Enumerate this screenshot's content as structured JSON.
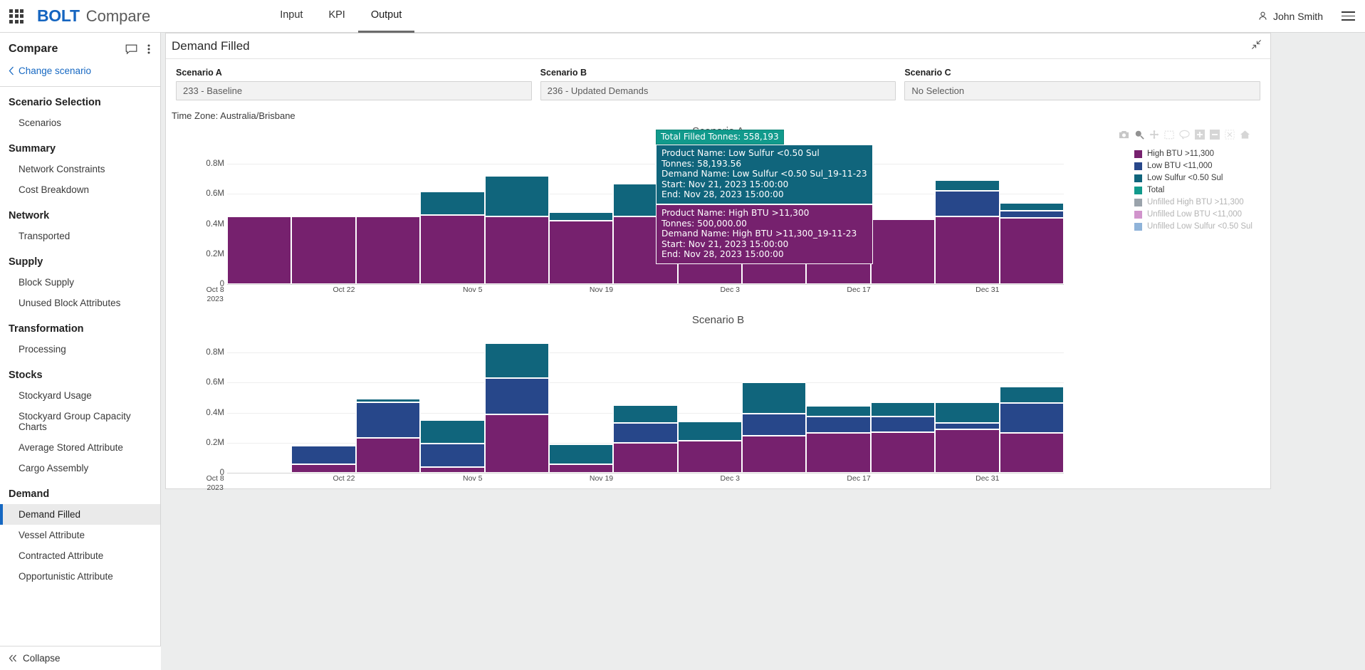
{
  "topbar": {
    "app_grid_icon": "waffle-grid-icon",
    "brand_primary": "BOLT",
    "brand_secondary": "Compare",
    "nav": [
      {
        "label": "Input",
        "active": false
      },
      {
        "label": "KPI",
        "active": false
      },
      {
        "label": "Output",
        "active": true
      }
    ],
    "user_name": "John Smith",
    "user_icon": "person-icon",
    "menu_icon": "hamburger-icon"
  },
  "sidebar": {
    "title": "Compare",
    "comment_icon": "comment-icon",
    "more_icon": "more-vertical-icon",
    "change_scenario": "Change scenario",
    "back_icon": "chevron-left-icon",
    "collapse_label": "Collapse",
    "collapse_icon": "double-chevron-left-icon",
    "groups": [
      {
        "title": "Scenario Selection",
        "items": [
          {
            "label": "Scenarios",
            "active": false
          }
        ]
      },
      {
        "title": "Summary",
        "items": [
          {
            "label": "Network Constraints",
            "active": false
          },
          {
            "label": "Cost Breakdown",
            "active": false
          }
        ]
      },
      {
        "title": "Network",
        "items": [
          {
            "label": "Transported",
            "active": false
          }
        ]
      },
      {
        "title": "Supply",
        "items": [
          {
            "label": "Block Supply",
            "active": false
          },
          {
            "label": "Unused Block Attributes",
            "active": false
          }
        ]
      },
      {
        "title": "Transformation",
        "items": [
          {
            "label": "Processing",
            "active": false
          }
        ]
      },
      {
        "title": "Stocks",
        "items": [
          {
            "label": "Stockyard Usage",
            "active": false
          },
          {
            "label": "Stockyard Group Capacity Charts",
            "active": false
          },
          {
            "label": "Average Stored Attribute",
            "active": false
          },
          {
            "label": "Cargo Assembly",
            "active": false
          }
        ]
      },
      {
        "title": "Demand",
        "items": [
          {
            "label": "Demand Filled",
            "active": true
          },
          {
            "label": "Vessel Attribute",
            "active": false
          },
          {
            "label": "Contracted Attribute",
            "active": false
          },
          {
            "label": "Opportunistic Attribute",
            "active": false
          }
        ]
      }
    ]
  },
  "panel": {
    "title": "Demand Filled",
    "collapse_icon": "collapse-diagonal-icon",
    "scenarios": [
      {
        "label": "Scenario A",
        "value": "233 - Baseline"
      },
      {
        "label": "Scenario B",
        "value": "236 - Updated Demands"
      },
      {
        "label": "Scenario C",
        "value": "No Selection"
      }
    ],
    "timezone": "Time Zone: Australia/Brisbane",
    "toolbar_icons": [
      "camera-icon",
      "zoom-icon",
      "pan-icon",
      "box-select-icon",
      "lasso-select-icon",
      "zoom-in-icon",
      "zoom-out-icon",
      "autoscale-icon",
      "reset-axes-home-icon"
    ]
  },
  "tooltip": {
    "total_label": "Total Filled Tonnes: 558,193",
    "blocks": [
      {
        "color": "#10657c",
        "lines": [
          "Product Name: Low Sulfur <0.50 Sul",
          "Tonnes: 58,193.56",
          "Demand Name: Low Sulfur <0.50 Sul_19-11-23",
          "Start: Nov 21, 2023 15:00:00",
          "End: Nov 28, 2023 15:00:00"
        ]
      },
      {
        "color": "#76216e",
        "lines": [
          "Product Name: High BTU >11,300",
          "Tonnes: 500,000.00",
          "Demand Name: High BTU >11,300_19-11-23",
          "Start: Nov 21, 2023 15:00:00",
          "End: Nov 28, 2023 15:00:00"
        ]
      }
    ]
  },
  "colors": {
    "high_btu": "#76216e",
    "low_btu": "#27478a",
    "low_sulfur": "#10657c",
    "total": "#119a8c",
    "unfilled_high_btu": "#9aa3ab",
    "unfilled_low_btu": "#d194cc",
    "unfilled_low_sulfur": "#8fb3d9",
    "accent_blue": "#1668c2"
  },
  "chart_data": [
    {
      "type": "bar",
      "title": "Scenario A",
      "barmode": "stacked",
      "xlabel": "",
      "ylabel": "",
      "ylim": [
        0,
        900000
      ],
      "yticks": [
        0,
        200000,
        400000,
        600000,
        800000
      ],
      "ytick_labels": [
        "0",
        "0.2M",
        "0.4M",
        "0.6M",
        "0.8M"
      ],
      "grid": true,
      "legend_position": "right",
      "xtick_labels": [
        "Oct 8\n2023",
        "Oct 22",
        "Nov 5",
        "Nov 19",
        "Dec 3",
        "Dec 17",
        "Dec 31"
      ],
      "categories": [
        "Oct 8",
        "Oct 15",
        "Oct 22",
        "Oct 29",
        "Nov 5",
        "Nov 12",
        "Nov 19",
        "Nov 26",
        "Dec 3",
        "Dec 10",
        "Dec 17",
        "Dec 24",
        "Dec 31"
      ],
      "series": [
        {
          "name": "High BTU >11,300",
          "color": "#76216e",
          "values": [
            450000,
            450000,
            450000,
            460000,
            450000,
            420000,
            450000,
            500000,
            500000,
            450000,
            430000,
            450000,
            440000
          ]
        },
        {
          "name": "Low BTU <11,000",
          "color": "#27478a",
          "values": [
            0,
            0,
            0,
            0,
            0,
            0,
            0,
            0,
            0,
            0,
            0,
            170000,
            50000
          ]
        },
        {
          "name": "Low Sulfur <0.50 Sul",
          "color": "#10657c",
          "values": [
            0,
            0,
            0,
            155000,
            270000,
            60000,
            220000,
            58193,
            30000,
            0,
            0,
            70000,
            50000
          ]
        },
        {
          "name": "Total",
          "color": "#119a8c",
          "values": []
        },
        {
          "name": "Unfilled High BTU >11,300",
          "color": "#9aa3ab",
          "values": []
        },
        {
          "name": "Unfilled Low BTU <11,000",
          "color": "#d194cc",
          "values": []
        },
        {
          "name": "Unfilled Low Sulfur <0.50 Sul",
          "color": "#8fb3d9",
          "values": []
        }
      ]
    },
    {
      "type": "bar",
      "title": "Scenario B",
      "barmode": "stacked",
      "xlabel": "",
      "ylabel": "",
      "ylim": [
        0,
        900000
      ],
      "yticks": [
        0,
        200000,
        400000,
        600000,
        800000
      ],
      "ytick_labels": [
        "0",
        "0.2M",
        "0.4M",
        "0.6M",
        "0.8M"
      ],
      "grid": true,
      "legend_position": "right",
      "xtick_labels": [
        "Oct 8\n2023",
        "Oct 22",
        "Nov 5",
        "Nov 19",
        "Dec 3",
        "Dec 17",
        "Dec 31"
      ],
      "categories": [
        "Oct 8",
        "Oct 15",
        "Oct 22",
        "Oct 29",
        "Nov 5",
        "Nov 12",
        "Nov 19",
        "Nov 26",
        "Dec 3",
        "Dec 10",
        "Dec 17",
        "Dec 24",
        "Dec 31"
      ],
      "series": [
        {
          "name": "High BTU >11,300",
          "color": "#76216e",
          "values": [
            8000,
            55000,
            230000,
            40000,
            390000,
            55000,
            200000,
            215000,
            245000,
            265000,
            270000,
            290000,
            265000
          ]
        },
        {
          "name": "Low BTU <11,000",
          "color": "#27478a",
          "values": [
            0,
            125000,
            240000,
            155000,
            240000,
            0,
            130000,
            0,
            150000,
            110000,
            105000,
            40000,
            200000
          ]
        },
        {
          "name": "Low Sulfur <0.50 Sul",
          "color": "#10657c",
          "values": [
            0,
            0,
            25000,
            155000,
            230000,
            135000,
            120000,
            125000,
            205000,
            70000,
            95000,
            140000,
            110000
          ]
        },
        {
          "name": "Total",
          "color": "#119a8c",
          "values": []
        },
        {
          "name": "Unfilled High BTU >11,300",
          "color": "#9aa3ab",
          "values": []
        },
        {
          "name": "Unfilled Low BTU <11,000",
          "color": "#d194cc",
          "values": []
        },
        {
          "name": "Unfilled Low Sulfur <0.50 Sul",
          "color": "#8fb3d9",
          "values": []
        }
      ]
    }
  ],
  "legend": [
    {
      "label": "High BTU >11,300",
      "color": "#76216e",
      "dimmed": false
    },
    {
      "label": "Low BTU <11,000",
      "color": "#27478a",
      "dimmed": false
    },
    {
      "label": "Low Sulfur <0.50 Sul",
      "color": "#10657c",
      "dimmed": false
    },
    {
      "label": "Total",
      "color": "#119a8c",
      "dimmed": false
    },
    {
      "label": "Unfilled High BTU >11,300",
      "color": "#9aa3ab",
      "dimmed": true
    },
    {
      "label": "Unfilled Low BTU <11,000",
      "color": "#d194cc",
      "dimmed": true
    },
    {
      "label": "Unfilled Low Sulfur <0.50 Sul",
      "color": "#8fb3d9",
      "dimmed": true
    }
  ]
}
